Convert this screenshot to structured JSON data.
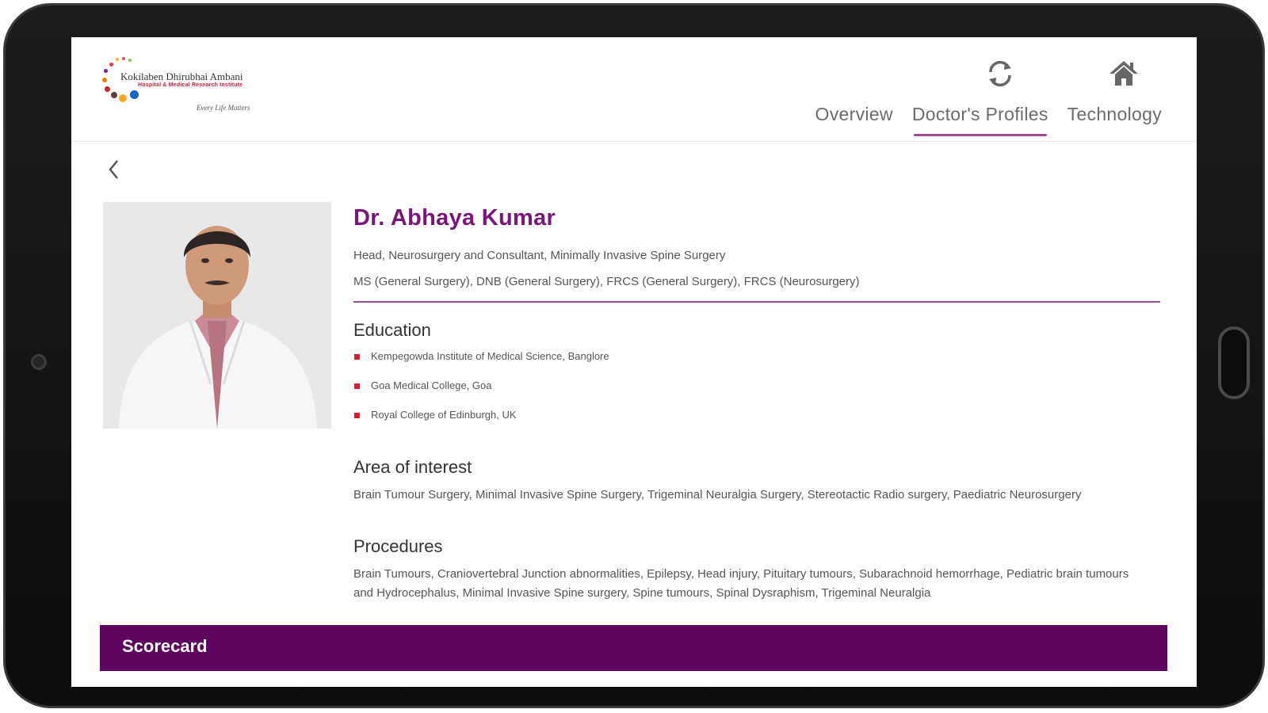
{
  "header": {
    "logo": {
      "name": "Kokilaben Dhirubhai Ambani",
      "subtitle": "Hospital & Medical Research Institute",
      "tagline": "Every Life Matters"
    },
    "icons": {
      "refresh": "refresh-icon",
      "home": "home-icon"
    },
    "nav": [
      "Overview",
      "Doctor's Profiles",
      "Technology"
    ],
    "active_tab": "Doctor's Profiles"
  },
  "profile": {
    "name": "Dr. Abhaya Kumar",
    "designation": "Head, Neurosurgery and Consultant, Minimally Invasive Spine Surgery",
    "degrees": "MS (General Surgery), DNB (General Surgery), FRCS (General Surgery), FRCS (Neurosurgery)"
  },
  "education": {
    "title": "Education",
    "items": [
      "Kempegowda Institute of Medical Science, Banglore",
      "Goa Medical College, Goa",
      "Royal College of Edinburgh, UK"
    ]
  },
  "area_of_interest": {
    "title": "Area of interest",
    "text": "Brain Tumour Surgery, Minimal Invasive Spine Surgery, Trigeminal Neuralgia Surgery, Stereotactic Radio surgery, Paediatric Neurosurgery"
  },
  "procedures": {
    "title": "Procedures",
    "text": "Brain Tumours, Craniovertebral Junction abnormalities, Epilepsy, Head injury, Pituitary tumours, Subarachnoid hemorrhage, Pediatric brain tumours and Hydrocephalus, Minimal Invasive Spine surgery, Spine tumours, Spinal Dysraphism, Trigeminal Neuralgia"
  },
  "scorecard": {
    "label": "Scorecard"
  },
  "colors": {
    "brand_purple": "#5e045e",
    "name_purple": "#7a1579",
    "accent_line": "#a04b8c",
    "bullet_red": "#e2182f"
  }
}
